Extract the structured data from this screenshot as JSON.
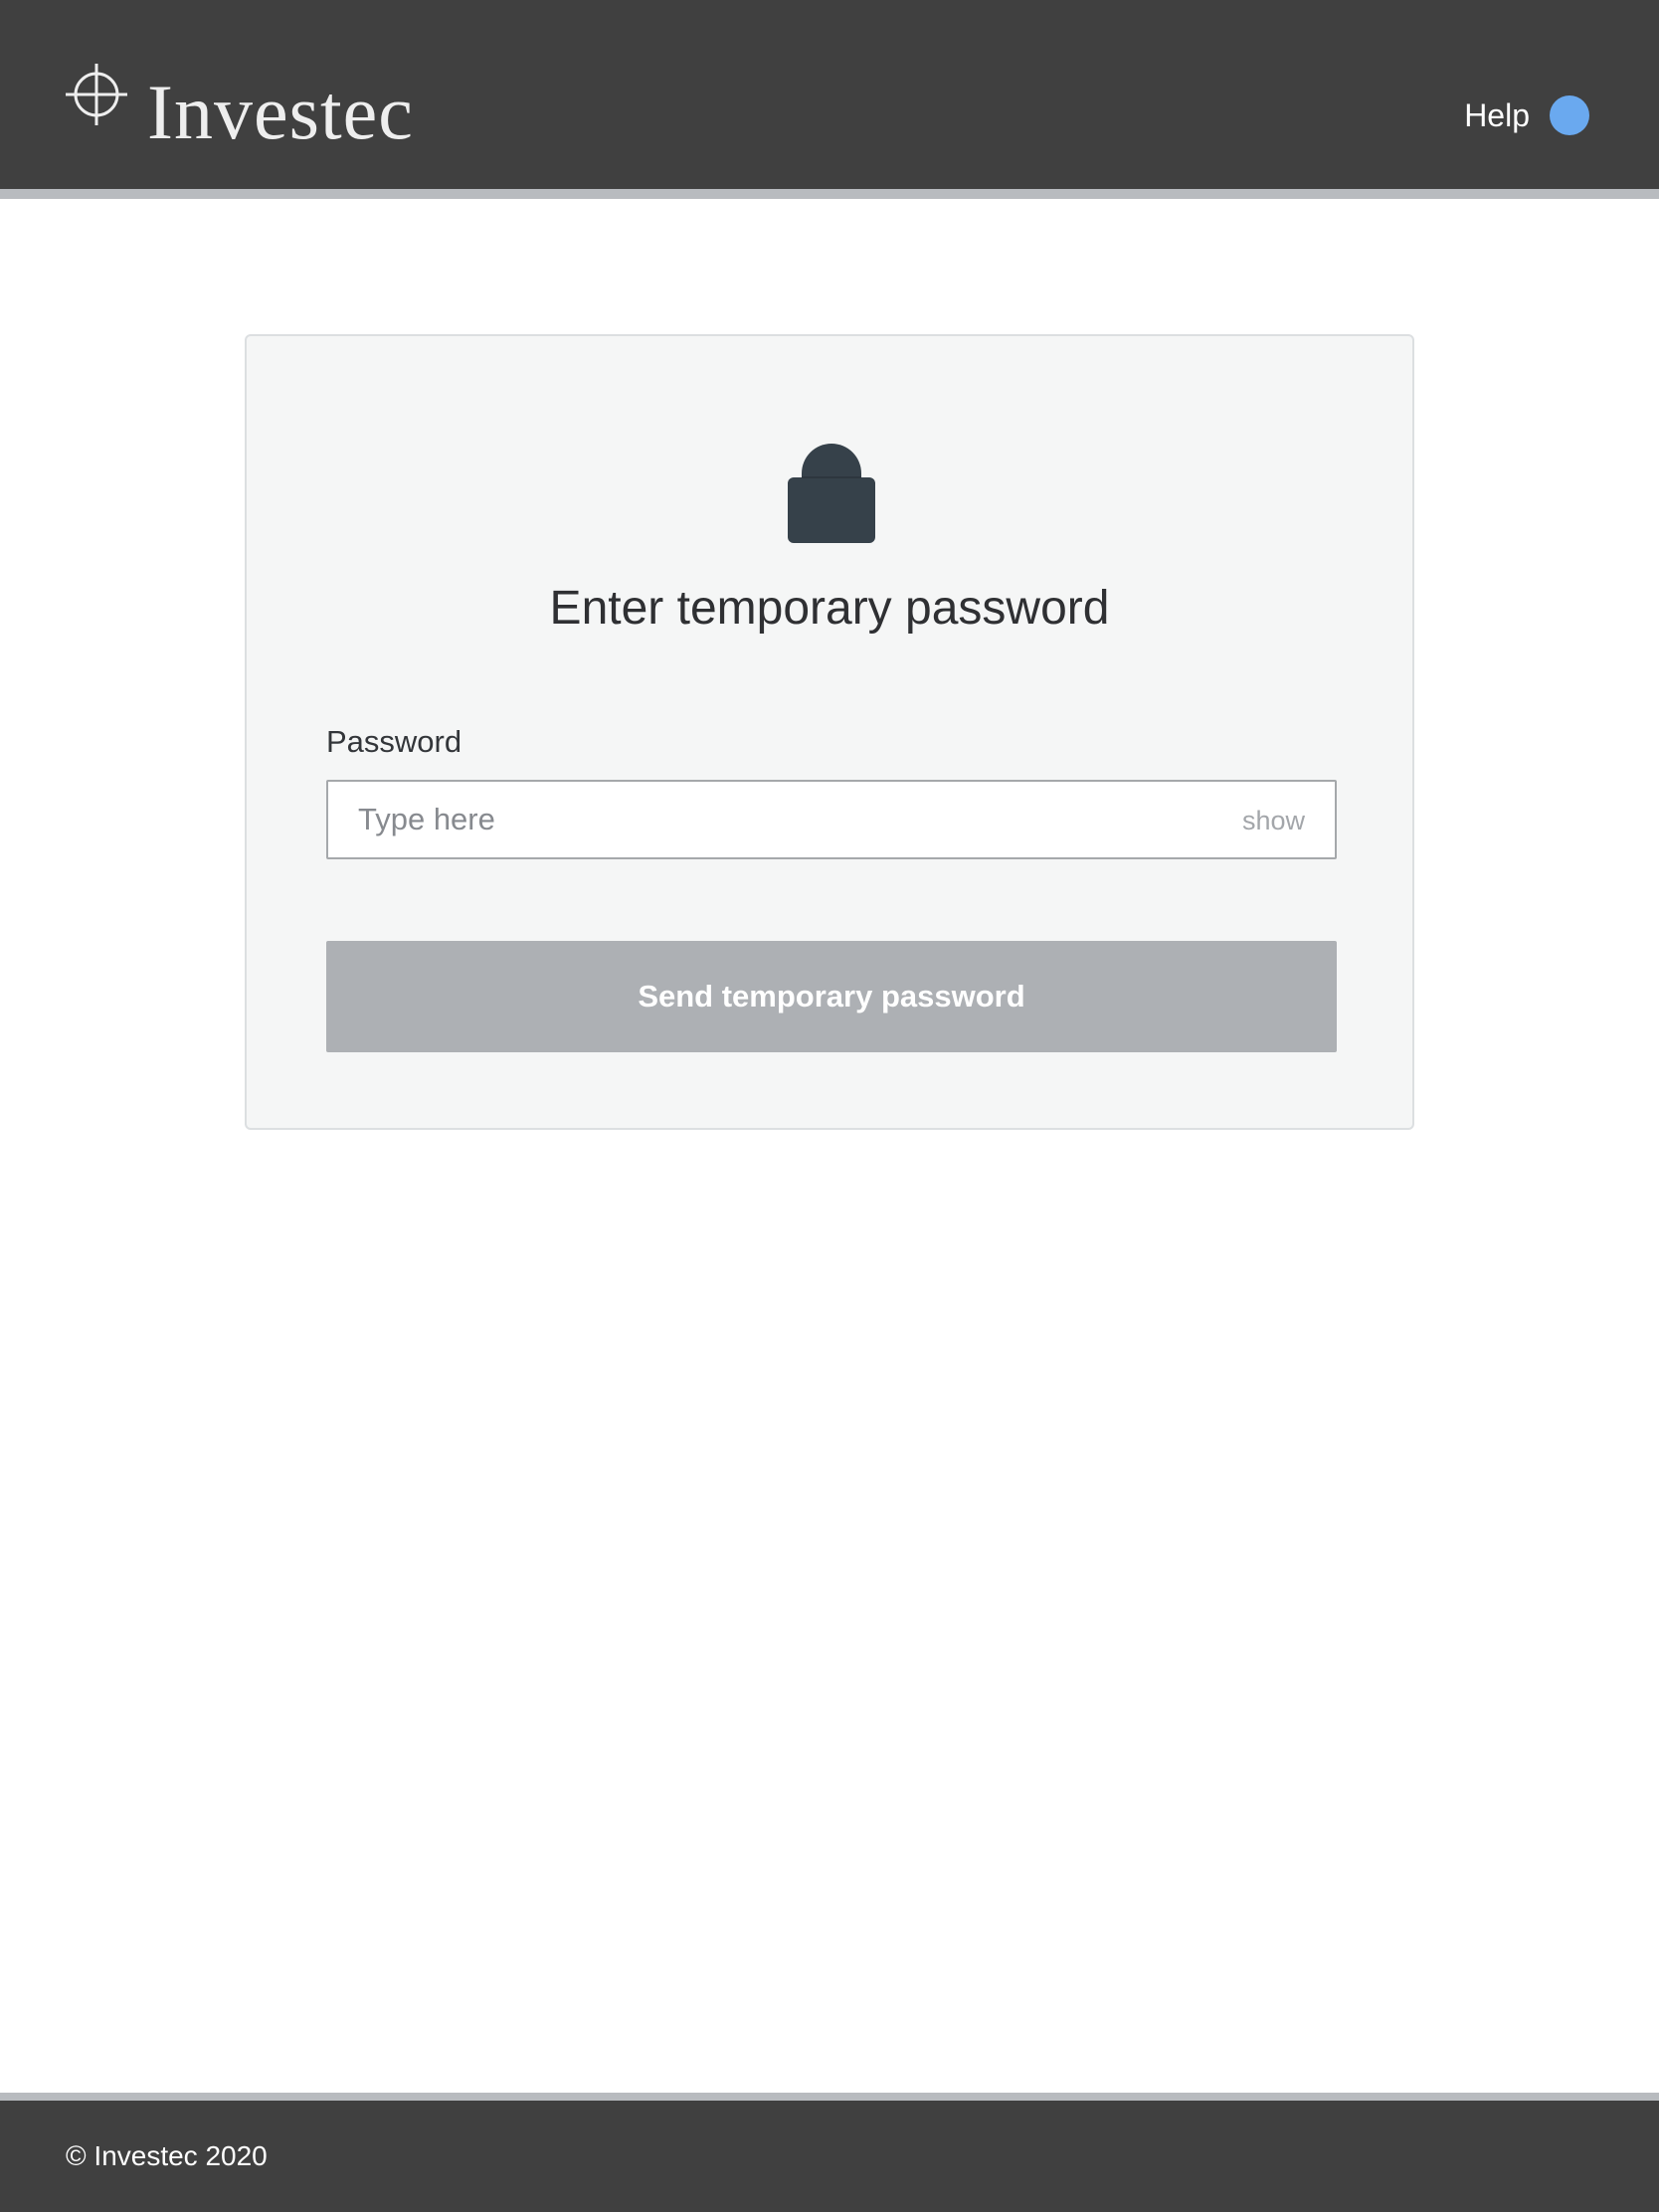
{
  "header": {
    "logo_text": "Investec",
    "help_label": "Help",
    "help_dot_color": "#6aa9ef",
    "background_color": "#404040"
  },
  "card": {
    "icon": "lock-icon",
    "title": "Enter temporary password",
    "password_field": {
      "label": "Password",
      "value": "",
      "placeholder": "Type here",
      "toggle_label": "show"
    },
    "submit_button": {
      "label": "Send temporary password",
      "state": "disabled",
      "color": "#adb0b4"
    }
  },
  "footer": {
    "copyright": "© Investec 2020"
  }
}
